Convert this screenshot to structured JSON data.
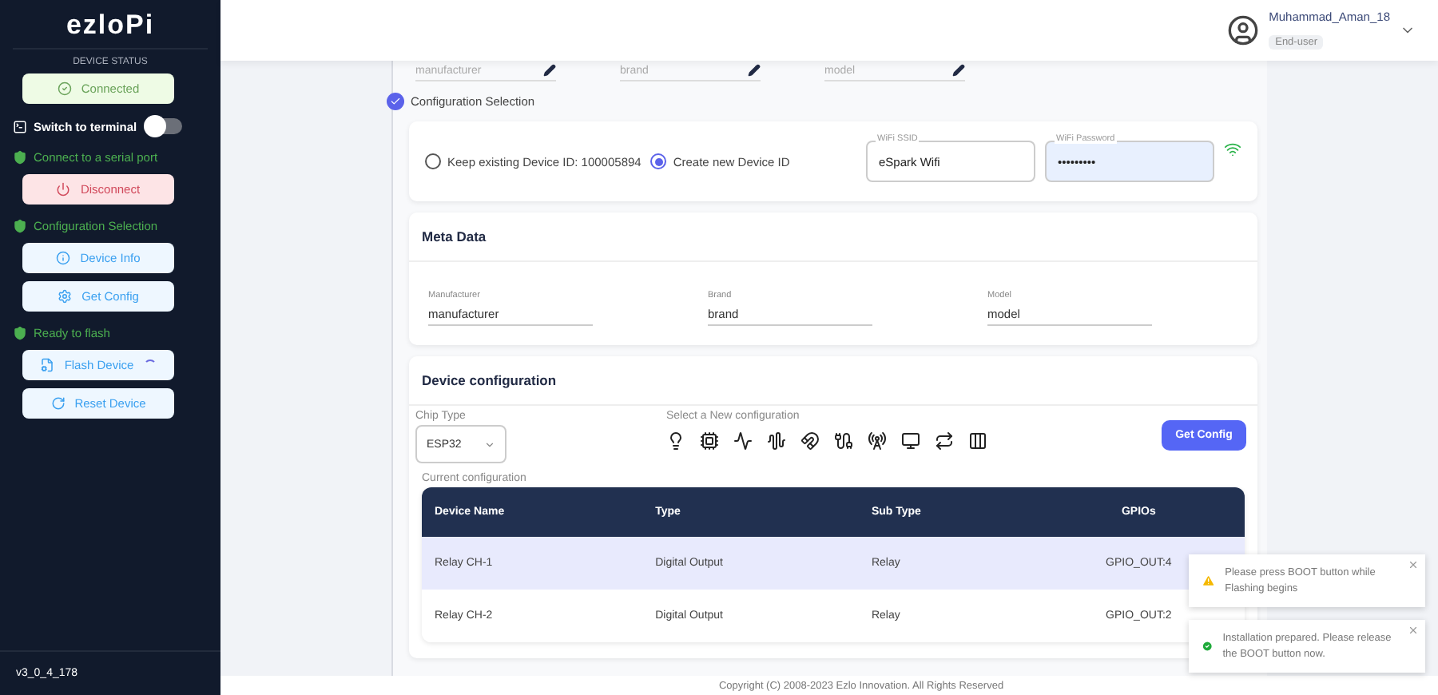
{
  "sidebar": {
    "logo": "ezloPi",
    "status_heading": "DEVICE STATUS",
    "status_button": {
      "label": "Connected",
      "kind": "success"
    },
    "terminal_switch": {
      "label": "Switch to terminal",
      "on": false
    },
    "steps": [
      {
        "label": "Connect to a serial port",
        "done": true,
        "buttons": [
          {
            "label": "Disconnect",
            "kind": "danger",
            "busy": false
          }
        ]
      },
      {
        "label": "Configuration Selection",
        "done": true,
        "buttons": [
          {
            "label": "Device Info",
            "kind": "info",
            "busy": false
          },
          {
            "label": "Get Config",
            "kind": "info",
            "busy": false
          }
        ]
      },
      {
        "label": "Ready to flash",
        "done": true,
        "buttons": [
          {
            "label": "Flash Device",
            "kind": "info",
            "busy": true
          },
          {
            "label": "Reset Device",
            "kind": "info",
            "busy": false
          }
        ]
      }
    ],
    "version": "v3_0_4_178"
  },
  "header": {
    "user_name": "Muhammad_Aman_18",
    "role": "End-user"
  },
  "top_fields": [
    {
      "placeholder": "manufacturer"
    },
    {
      "placeholder": "brand"
    },
    {
      "placeholder": "model"
    }
  ],
  "config_step": {
    "label": "Configuration Selection",
    "done": true
  },
  "device_id_options": [
    {
      "label": "Keep existing Device ID: 100005894",
      "selected": false
    },
    {
      "label": "Create new Device ID",
      "selected": true
    }
  ],
  "wifi": {
    "ssid_label": "WiFi SSID",
    "ssid": "eSpark Wifi",
    "password_label": "WiFi Password",
    "password": "•••••••••"
  },
  "meta_data": {
    "title": "Meta Data",
    "fields": [
      {
        "label": "Manufacturer",
        "value": "manufacturer"
      },
      {
        "label": "Brand",
        "value": "brand"
      },
      {
        "label": "Model",
        "value": "model"
      }
    ]
  },
  "device_configuration": {
    "title": "Device configuration",
    "chip_type_label": "Chip Type",
    "chip_type": "ESP32",
    "select_label": "Select a New configuration",
    "get_config_button": "Get Config",
    "current_label": "Current configuration",
    "table": {
      "columns": [
        "Device Name",
        "Type",
        "Sub Type",
        "GPIOs"
      ],
      "rows": [
        {
          "cells": [
            "Relay CH-1",
            "Digital Output",
            "Relay",
            "GPIO_OUT:4"
          ],
          "selected": true
        },
        {
          "cells": [
            "Relay CH-2",
            "Digital Output",
            "Relay",
            "GPIO_OUT:2"
          ],
          "selected": false
        }
      ]
    }
  },
  "toasts": [
    {
      "kind": "warning",
      "text": "Please press BOOT button while Flashing begins"
    },
    {
      "kind": "success",
      "text": "Installation prepared. Please release the BOOT button now."
    }
  ],
  "footer": "Copyright (C) 2008-2023 Ezlo Innovation. All Rights Reserved"
}
